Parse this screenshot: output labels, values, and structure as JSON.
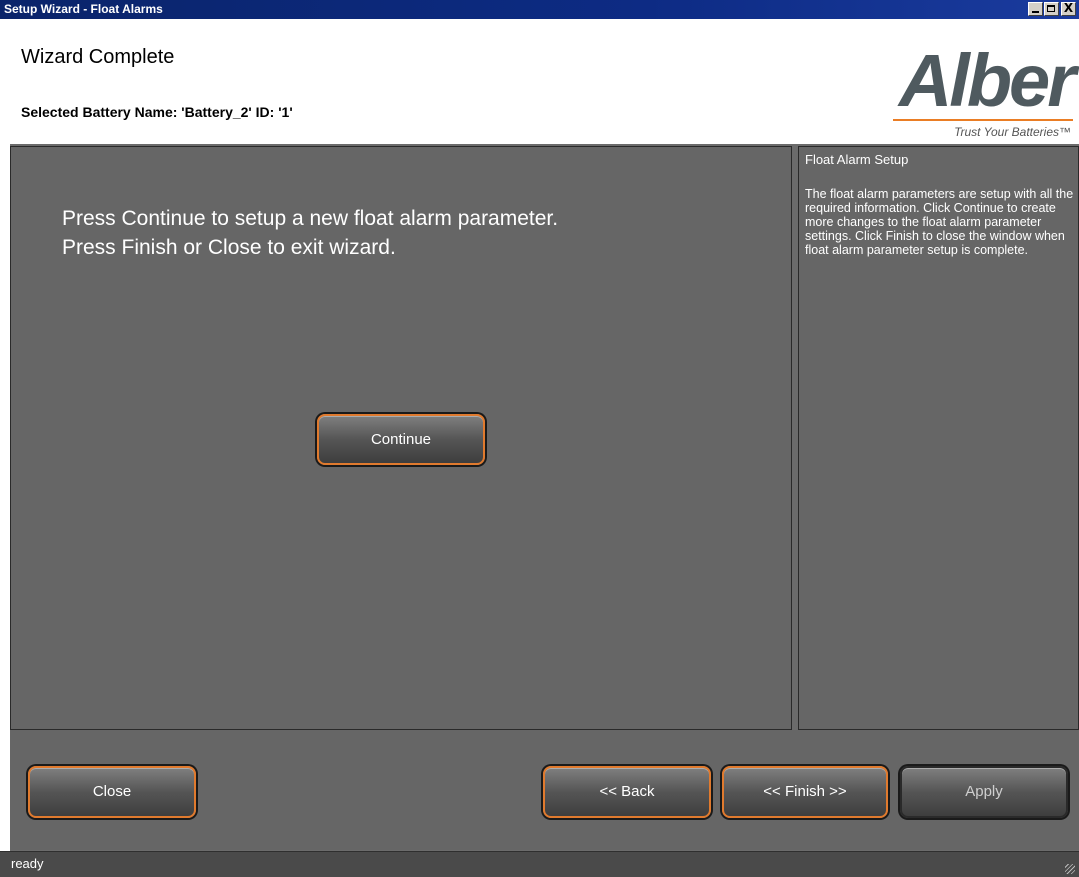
{
  "window": {
    "title": "Setup Wizard - Float Alarms",
    "controls": {
      "minimize_icon": "minimize-icon",
      "maximize_icon": "maximize-icon",
      "close_glyph": "X"
    }
  },
  "header": {
    "title": "Wizard Complete",
    "selected_battery": "Selected Battery Name: 'Battery_2' ID: '1'",
    "logo": {
      "brand": "Alber",
      "tagline": "Trust Your Batteries™",
      "accent_color": "#ea7d24",
      "brand_color": "#4f5a5f"
    }
  },
  "main": {
    "line1": "Press Continue to setup a new float alarm parameter.",
    "line2": "Press Finish or Close to exit wizard.",
    "continue_label": "Continue"
  },
  "side": {
    "title": "Float Alarm Setup",
    "body": "The float alarm parameters are setup with all the required information. Click Continue to create more changes to the float alarm parameter settings. Click Finish to close the window when float alarm parameter setup is complete."
  },
  "footer": {
    "close_label": "Close",
    "back_label": "<< Back",
    "finish_label": "<< Finish >>",
    "apply_label": "Apply"
  },
  "status": {
    "text": "ready"
  },
  "colors": {
    "panel_bg": "#666666",
    "button_border": "#e07a2e",
    "titlebar": "#0a246a"
  }
}
